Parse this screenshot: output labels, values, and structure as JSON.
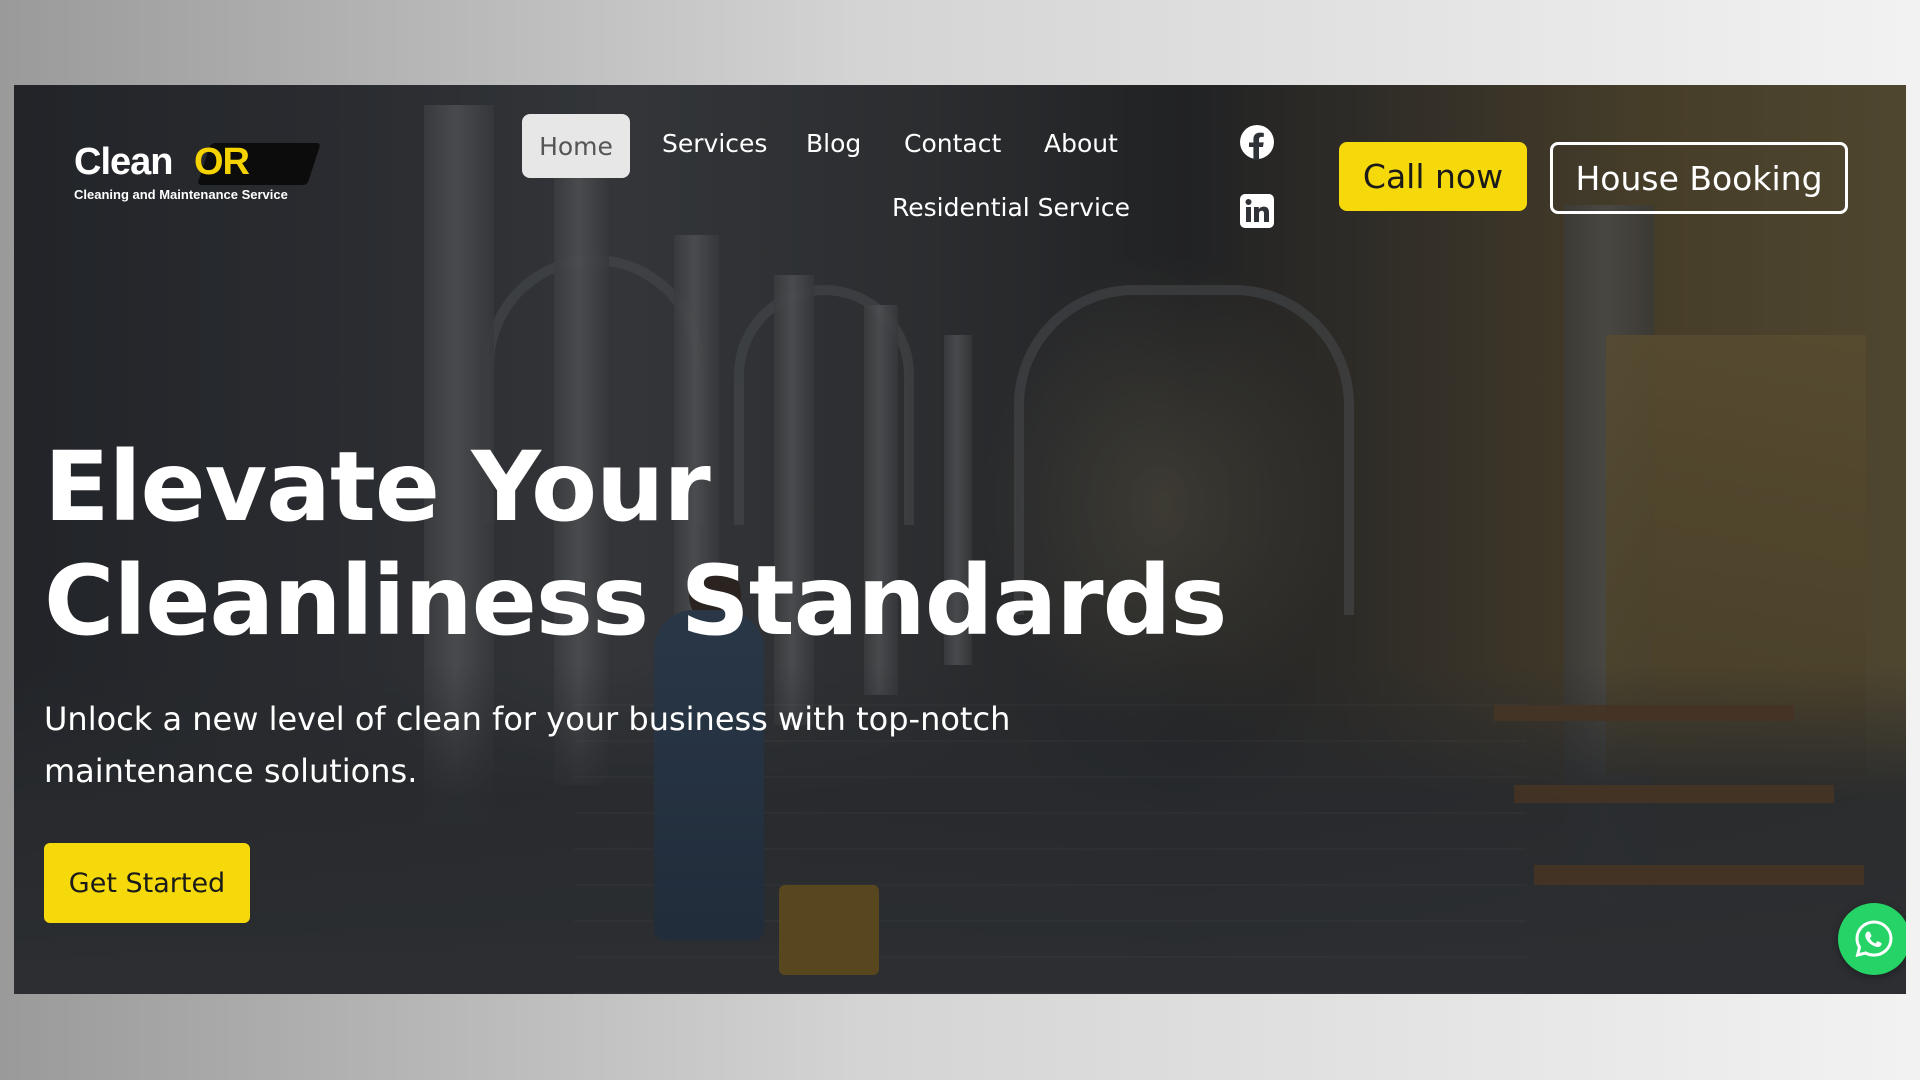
{
  "logo": {
    "name_part1": "Clean",
    "name_part2": "OR",
    "tagline": "Cleaning and Maintenance Service"
  },
  "nav": {
    "items": [
      {
        "label": "Home",
        "active": true
      },
      {
        "label": "Services"
      },
      {
        "label": "Blog"
      },
      {
        "label": "Contact"
      },
      {
        "label": "About"
      },
      {
        "label": "Residential Service"
      }
    ]
  },
  "social": {
    "icons": [
      "facebook-icon",
      "linkedin-icon"
    ]
  },
  "header_buttons": {
    "call": "Call now",
    "booking": "House Booking"
  },
  "hero": {
    "title_line1": "Elevate Your",
    "title_line2": "Cleanliness Standards",
    "subtitle_line1": "Unlock a new level of clean for your business with top-notch",
    "subtitle_line2": "maintenance solutions.",
    "cta": "Get Started"
  },
  "floating": {
    "icon": "whatsapp-icon"
  },
  "colors": {
    "accent": "#f5d90a",
    "whatsapp": "#25d366",
    "text": "#ffffff"
  }
}
